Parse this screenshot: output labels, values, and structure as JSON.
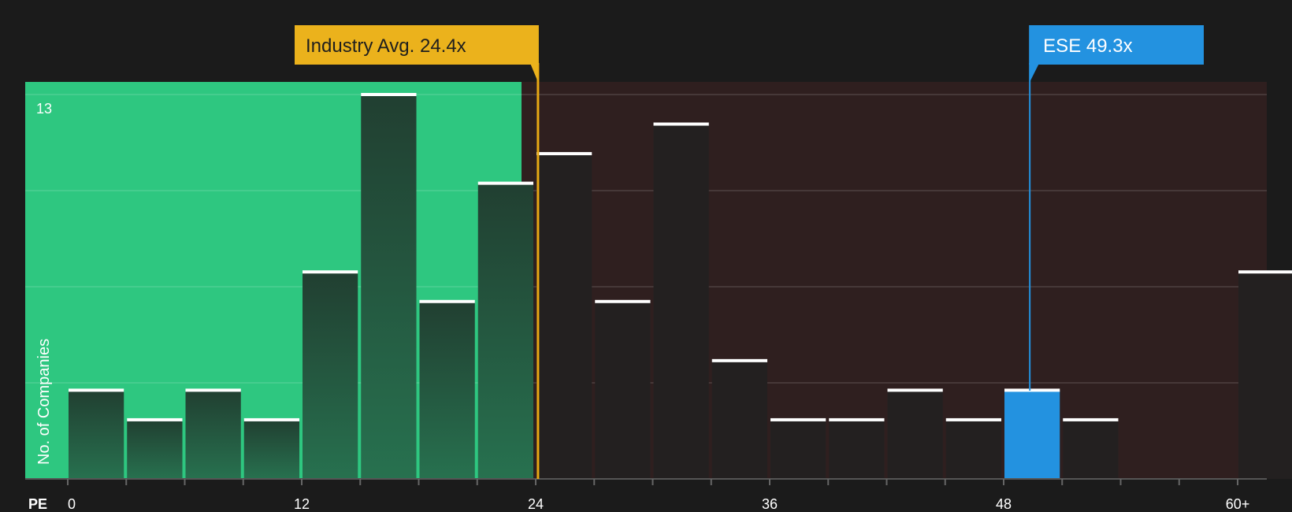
{
  "chart_data": {
    "type": "bar",
    "x_axis_label": "PE",
    "y_axis_label": "No. of Companies",
    "y_max_label": "13",
    "x_ticks": [
      "0",
      "12",
      "24",
      "36",
      "48",
      "60+"
    ],
    "bins": [
      {
        "x0": 0,
        "x1": 3,
        "value": 3
      },
      {
        "x0": 3,
        "x1": 6,
        "value": 2
      },
      {
        "x0": 6,
        "x1": 9,
        "value": 3
      },
      {
        "x0": 9,
        "x1": 12,
        "value": 2
      },
      {
        "x0": 12,
        "x1": 15,
        "value": 7
      },
      {
        "x0": 15,
        "x1": 18,
        "value": 13
      },
      {
        "x0": 18,
        "x1": 21,
        "value": 6
      },
      {
        "x0": 21,
        "x1": 24,
        "value": 10
      },
      {
        "x0": 24,
        "x1": 27,
        "value": 11
      },
      {
        "x0": 27,
        "x1": 30,
        "value": 6
      },
      {
        "x0": 30,
        "x1": 33,
        "value": 12
      },
      {
        "x0": 33,
        "x1": 36,
        "value": 4
      },
      {
        "x0": 36,
        "x1": 39,
        "value": 2
      },
      {
        "x0": 39,
        "x1": 42,
        "value": 2
      },
      {
        "x0": 42,
        "x1": 45,
        "value": 3
      },
      {
        "x0": 45,
        "x1": 48,
        "value": 2
      },
      {
        "x0": 48,
        "x1": 51,
        "value": 3,
        "highlight": true
      },
      {
        "x0": 51,
        "x1": 54,
        "value": 2
      },
      {
        "x0": 54,
        "x1": 57,
        "value": 0
      },
      {
        "x0": 57,
        "x1": 60,
        "value": 0
      },
      {
        "x0": 60,
        "x1": 63,
        "value": 7
      }
    ],
    "x_range": [
      0,
      63
    ],
    "y_range": [
      0,
      13
    ],
    "gridlines": [
      3.25,
      6.5,
      9.75,
      13
    ],
    "industry_avg": {
      "value": 24.4,
      "label": "Industry Avg. 24.4x"
    },
    "company": {
      "value": 49.3,
      "label": "ESE 49.3x"
    },
    "colors": {
      "background": "#1b1b1b",
      "good_zone": "#2ec780",
      "bad_zone": "#2f1f1f",
      "bar_in_good": "#224b37",
      "bar_in_bad": "#232020",
      "bar_top": "#ffffff",
      "highlight": "#2392e0",
      "avg_label": "#ebb21c",
      "avg_line": "#e8a814",
      "company_line": "#2392e0"
    }
  }
}
